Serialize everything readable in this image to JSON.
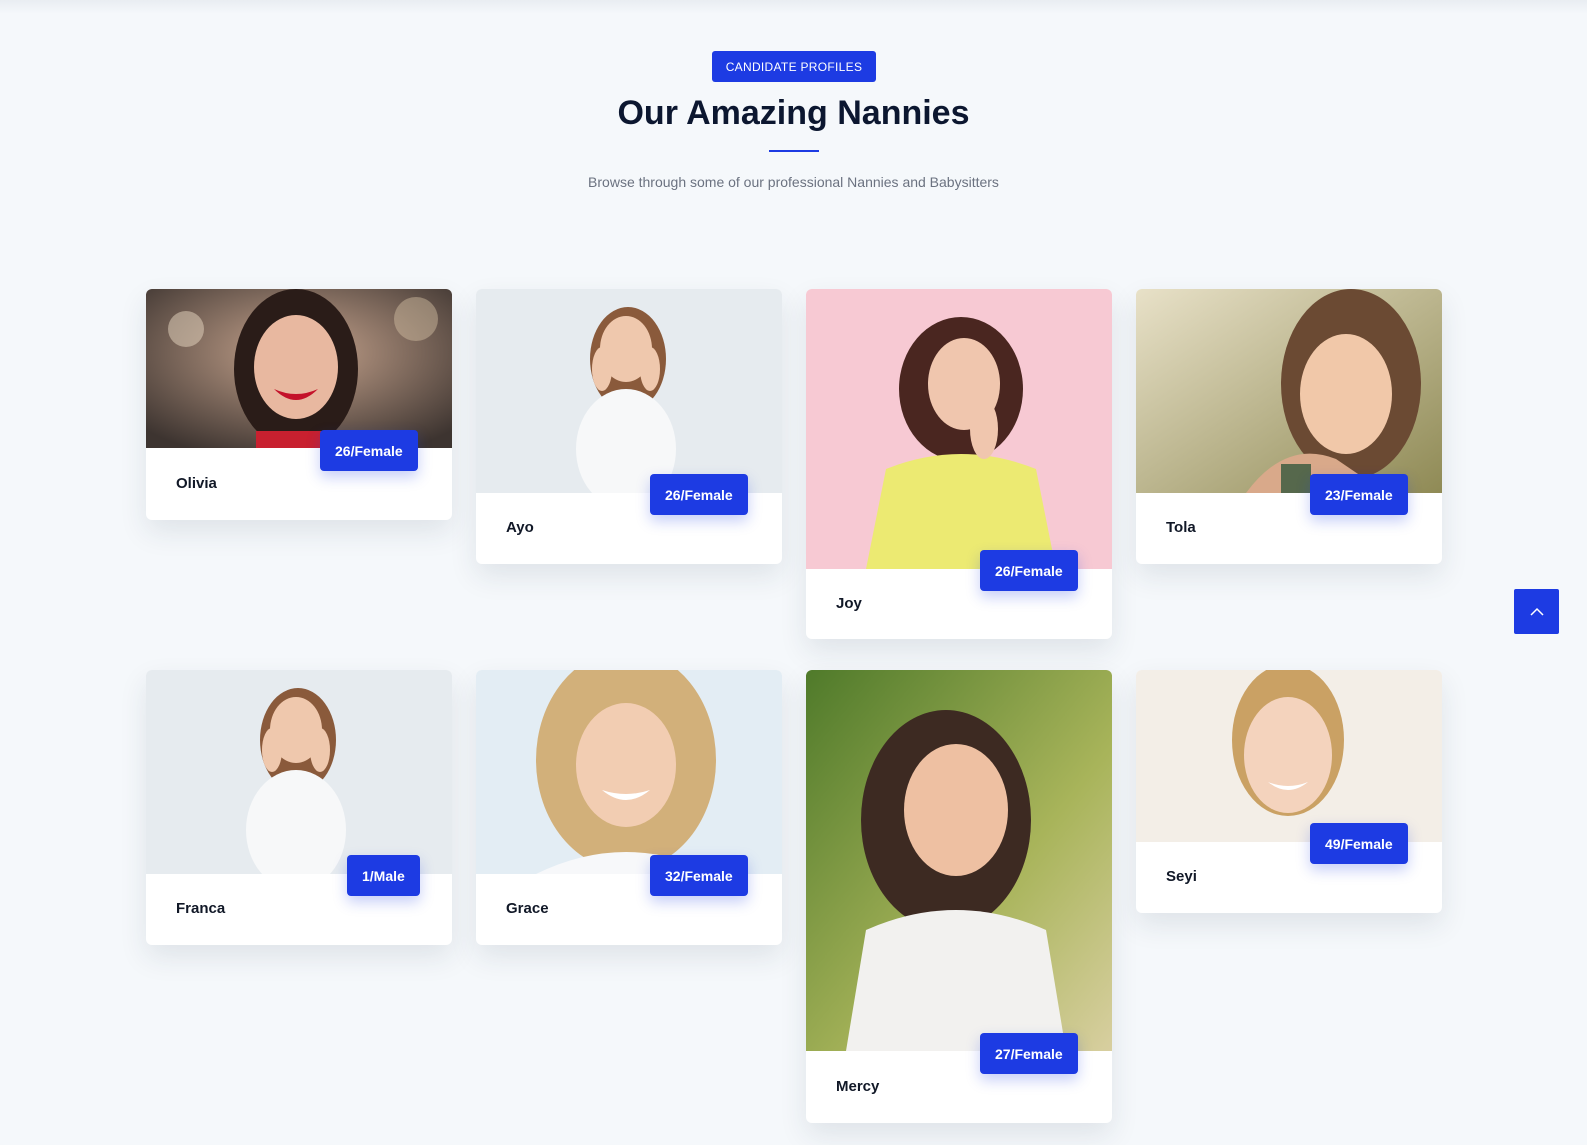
{
  "header": {
    "badge": "CANDIDATE PROFILES",
    "title": "Our Amazing Nannies",
    "subtitle": "Browse through some of our professional Nannies and Babysitters"
  },
  "cards": [
    {
      "name": "Olivia",
      "age": "26/Female",
      "photo": "photo-woman-smiling-red-lips"
    },
    {
      "name": "Ayo",
      "age": "26/Female",
      "photo": "photo-woman-hands-on-cheeks"
    },
    {
      "name": "Joy",
      "age": "26/Female",
      "photo": "photo-woman-pink-background"
    },
    {
      "name": "Tola",
      "age": "23/Female",
      "photo": "photo-woman-outdoors-sunlight"
    },
    {
      "name": "Franca",
      "age": "1/Male",
      "photo": "photo-woman-hands-on-cheeks"
    },
    {
      "name": "Grace",
      "age": "32/Female",
      "photo": "photo-blonde-woman-smiling"
    },
    {
      "name": "Mercy",
      "age": "27/Female",
      "photo": "photo-woman-laughing-garden"
    },
    {
      "name": "Seyi",
      "age": "49/Female",
      "photo": "photo-blonde-woman-studio"
    }
  ],
  "scroll_top": {
    "icon": "chevron-up-icon"
  },
  "colors": {
    "accent": "#1d3be3",
    "title": "#0c1730",
    "background": "#f5f8fb"
  }
}
